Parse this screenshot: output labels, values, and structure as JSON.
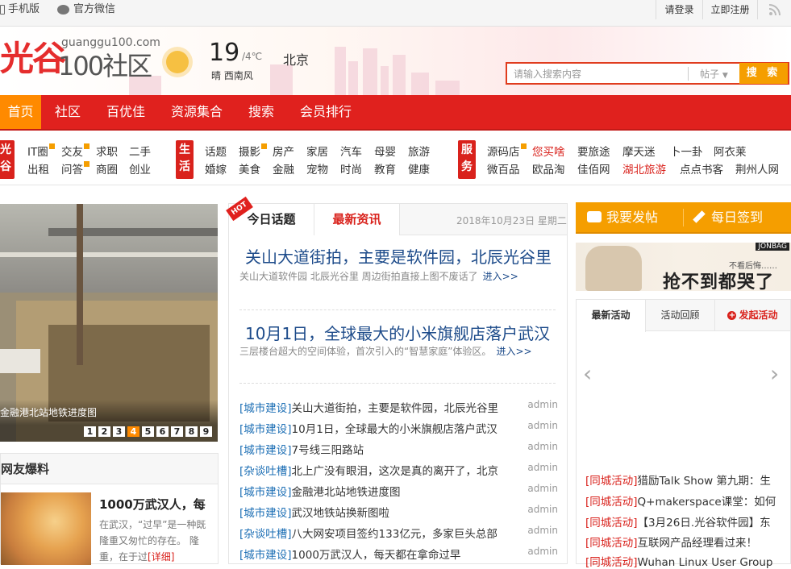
{
  "topbar": {
    "mobile": "手机版",
    "wechat": "官方微信",
    "login": "请登录",
    "register": "立即注册"
  },
  "header": {
    "logo_main": "光谷",
    "logo_domain": "guanggu100.com",
    "logo_sub": "100社区",
    "temp": "19",
    "temp_range": "/4℃",
    "city": "北京",
    "condition": "晴 西南风"
  },
  "search": {
    "placeholder": "请输入搜索内容",
    "type": "帖子",
    "button": "搜 索"
  },
  "nav": {
    "items": [
      "首页",
      "社区",
      "百优佳",
      "资源集合",
      "搜索",
      "会员排行"
    ]
  },
  "categories": {
    "groups": [
      {
        "label": "光谷",
        "rows": [
          [
            "IT圈",
            "交友",
            "求职",
            "二手"
          ],
          [
            "出租",
            "问答",
            "商圈",
            "创业"
          ]
        ]
      },
      {
        "label": "生活",
        "rows": [
          [
            "话题",
            "摄影",
            "房产",
            "家居",
            "汽车",
            "母婴",
            "旅游"
          ],
          [
            "婚嫁",
            "美食",
            "金融",
            "宠物",
            "时尚",
            "教育",
            "健康"
          ]
        ]
      },
      {
        "label": "服务",
        "rows": [
          [
            "源码店",
            "您买啥",
            "要旅途",
            "摩天迷",
            "卜一卦",
            "阿衣莱"
          ],
          [
            "微百品",
            "欧品淘",
            "佳佰网",
            "湖北旅游",
            "点点书客",
            "荆州人网"
          ]
        ]
      }
    ]
  },
  "slider": {
    "caption": "金融港北站地铁进度图",
    "pages": [
      "1",
      "2",
      "3",
      "4",
      "5",
      "6",
      "7",
      "8",
      "9"
    ],
    "active": "4"
  },
  "hot": {
    "title": "网友爆料",
    "headline": "1000万武汉人，每",
    "desc": "在武汉，“过早”是一种既隆重又匆忙的存在。 隆重，在于过",
    "more": "[详细]"
  },
  "mid": {
    "tab1": "今日话题",
    "tab2": "最新资讯",
    "badge": "HOT",
    "date": "2018年10月23日 星期二",
    "headlines": [
      {
        "title": "关山大道街拍，主要是软件园，北辰光谷里",
        "summary": "关山大道软件园 北辰光谷里 周边街拍直接上图不废话了",
        "more": "进入>>"
      },
      {
        "title": "10月1日，全球最大的小米旗舰店落户武汉",
        "summary": "三层楼台超大的空间体验，首次引入的“智慧家庭”体验区。",
        "more": "进入>>"
      }
    ],
    "rows": [
      {
        "tag": "[城市建设]",
        "title": "关山大道街拍，主要是软件园，北辰光谷里",
        "author": "admin"
      },
      {
        "tag": "[城市建设]",
        "title": "10月1日，全球最大的小米旗舰店落户武汉",
        "author": "admin"
      },
      {
        "tag": "[城市建设]",
        "title": "7号线三阳路站",
        "author": "admin"
      },
      {
        "tag": "[杂谈吐槽]",
        "title": "北上广没有眼泪，这次是真的离开了，北京",
        "author": "admin"
      },
      {
        "tag": "[城市建设]",
        "title": "金融港北站地铁进度图",
        "author": "admin"
      },
      {
        "tag": "[城市建设]",
        "title": "武汉地铁站换新图啦",
        "author": "admin"
      },
      {
        "tag": "[杂谈吐槽]",
        "title": "八大网安项目签约133亿元，多家巨头总部",
        "author": "admin"
      },
      {
        "tag": "[城市建设]",
        "title": "1000万武汉人，每天都在拿命过早",
        "author": "admin"
      }
    ]
  },
  "right": {
    "post": "我要发帖",
    "sign": "每日签到",
    "ad": {
      "brand": "JONBAG",
      "small": "不看后悔……",
      "big": "抢不到都哭了"
    },
    "tabs": [
      "最新活动",
      "活动回顾",
      "发起活动"
    ],
    "arrows": [
      "‹",
      "›"
    ],
    "activities": [
      {
        "tag": "[同城活动]",
        "title": "猎励Talk Show 第九期：生"
      },
      {
        "tag": "[同城活动]",
        "title": "Q+makerspace课堂：如何"
      },
      {
        "tag": "[同城活动]",
        "title": "【3月26日.光谷软件园】东"
      },
      {
        "tag": "[同城活动]",
        "title": "互联网产品经理看过来！"
      },
      {
        "tag": "[同城活动]",
        "title": "Wuhan Linux User Group"
      }
    ]
  },
  "colors": {
    "brand_red": "#e0211e",
    "accent_orange": "#f59e00",
    "link_blue": "#1d4b8a"
  }
}
